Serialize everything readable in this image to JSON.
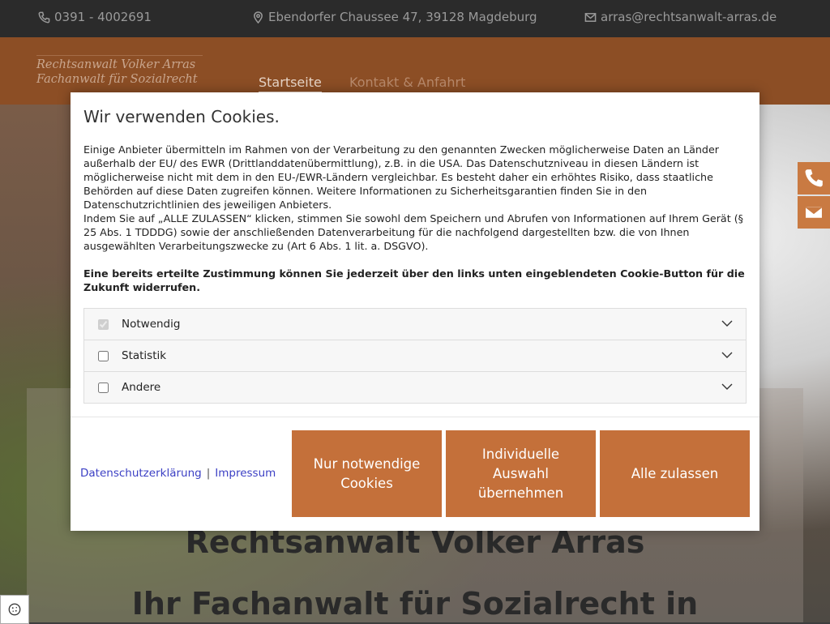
{
  "topbar": {
    "phone": "0391 - 4002691",
    "address": "Ebendorfer Chaussee 47, 39128 Magdeburg",
    "email": "arras@rechtsanwalt-arras.de"
  },
  "header": {
    "logo_line1": "Rechtsanwalt Volker Arras",
    "logo_line2": "Fachanwalt für Sozialrecht",
    "nav": [
      {
        "label": "Startseite",
        "active": true
      },
      {
        "label": "Kontakt & Anfahrt",
        "active": false
      }
    ]
  },
  "hero": {
    "title": "Rechtsanwalt Volker Arras",
    "subtitle": "Ihr Fachanwalt für Sozialrecht in"
  },
  "cookie_modal": {
    "heading": "Wir verwenden Cookies.",
    "para1": "Einige Anbieter übermitteln im Rahmen von der Verarbeitung zu den genannten Zwecken möglicherweise Daten an Länder außerhalb der EU/ des EWR (Drittlanddatenübermittlung), z.B. in die USA. Das Datenschutzniveau in diesen Ländern ist möglicherweise nicht mit dem in den EU-/EWR-Ländern vergleichbar. Es besteht daher ein erhöhtes Risiko, dass staatliche Behörden auf diese Daten zugreifen können. Weitere Informationen zu Sicherheitsgarantien finden Sie in den Datenschutzrichtlinien des jeweiligen Anbieters.",
    "para2": "Indem Sie auf „ALLE ZULASSEN“ klicken, stimmen Sie sowohl dem Speichern und Abrufen von Informationen auf Ihrem Gerät (§ 25 Abs. 1 TDDDG) sowie der anschließenden Datenverarbeitung für die nachfolgend dargestellten bzw. die von Ihnen ausgewählten Verarbeitungszwecke zu (Art 6 Abs. 1 lit. a. DSGVO).",
    "para3": "Eine bereits erteilte Zustimmung können Sie jederzeit über den links unten eingeblendeten Cookie-Button für die Zukunft widerrufen.",
    "categories": [
      {
        "label": "Notwendig",
        "checked": true,
        "disabled": true
      },
      {
        "label": "Statistik",
        "checked": false,
        "disabled": false
      },
      {
        "label": "Andere",
        "checked": false,
        "disabled": false
      }
    ],
    "link_privacy": "Datenschutzerklärung",
    "link_separator": "|",
    "link_imprint": "Impressum",
    "btn_necessary": "Nur notwendige Cookies",
    "btn_individual": "Individuelle Auswahl übernehmen",
    "btn_all": "Alle zulassen"
  },
  "colors": {
    "accent": "#c4703a",
    "header_bg": "#8c4e25",
    "topbar_bg": "#2b2b2b",
    "link": "#3b3fc4"
  },
  "icons": {
    "phone": "phone-icon",
    "location": "map-marker-icon",
    "email": "envelope-icon",
    "chevron": "chevron-down-icon",
    "cookie": "cookie-icon"
  }
}
